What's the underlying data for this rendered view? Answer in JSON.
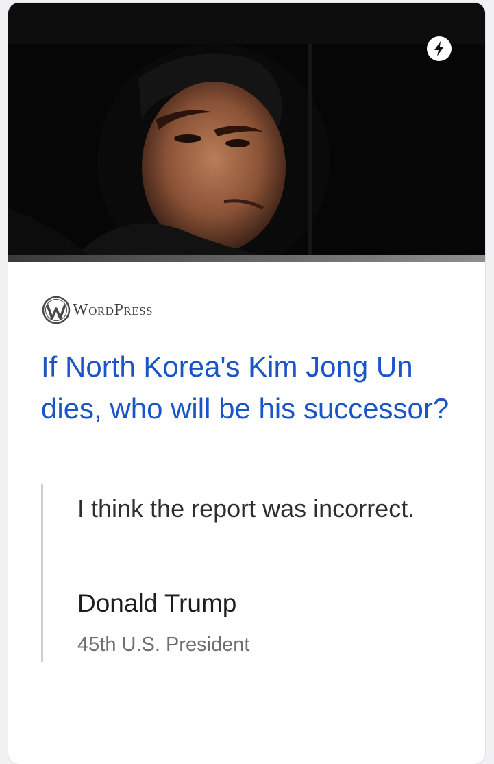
{
  "card": {
    "image_alt": "Kim Jong Un looking out of a car window",
    "amp_icon": "lightning-bolt-icon",
    "publisher": {
      "logo_icon": "wordpress-logo-icon",
      "name": "WordPress"
    },
    "headline": "If North Korea's Kim Jong Un dies, who will be his successor?",
    "quote": {
      "text": "I think the report was incorrect.",
      "author": "Donald Trump",
      "role": "45th U.S. President"
    }
  },
  "colors": {
    "headline": "#1a55c8",
    "background": "#f1f1f3",
    "card": "#ffffff"
  }
}
